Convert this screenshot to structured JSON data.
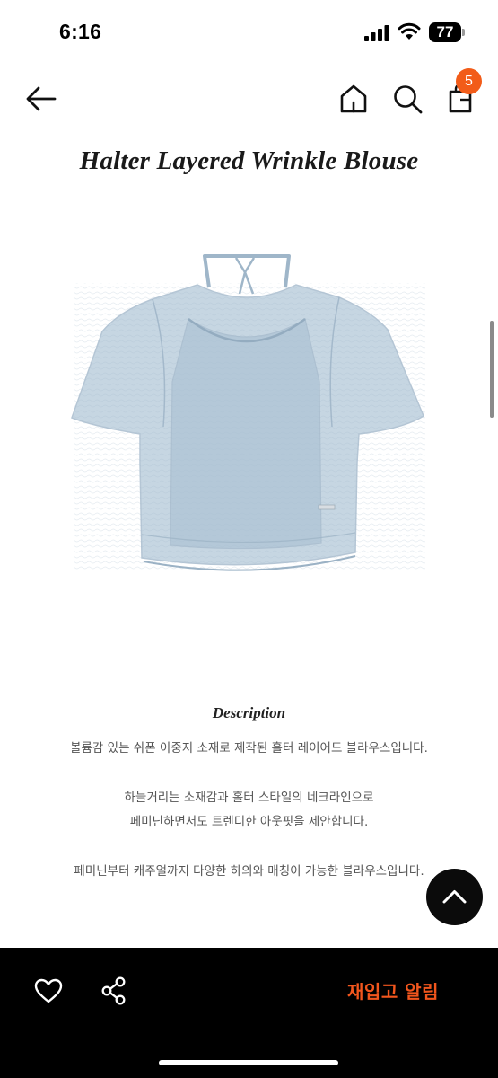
{
  "status_bar": {
    "time": "6:16",
    "battery": "77"
  },
  "header": {
    "cart_count": "5"
  },
  "product": {
    "title": "Halter Layered Wrinkle Blouse",
    "image_color": "#b7cbdb"
  },
  "description": {
    "heading": "Description",
    "lines": [
      "볼륨감 있는 쉬폰 이중지 소재로 제작된 홀터 레이어드 블라우스입니다.",
      "하늘거리는 소재감과 홀터 스타일의 네크라인으로",
      "페미닌하면서도 트렌디한 아웃핏을 제안합니다.",
      "페미닌부터 캐주얼까지 다양한 하의와 매칭이 가능한 블라우스입니다."
    ]
  },
  "bottom_bar": {
    "restock_label": "재입고 알림"
  },
  "colors": {
    "accent": "#f25c19",
    "bottom_bar_bg": "#000000"
  },
  "icons": [
    "back-arrow-icon",
    "home-icon",
    "search-icon",
    "shopping-bag-icon",
    "chevron-up-icon",
    "heart-icon",
    "share-icon"
  ]
}
